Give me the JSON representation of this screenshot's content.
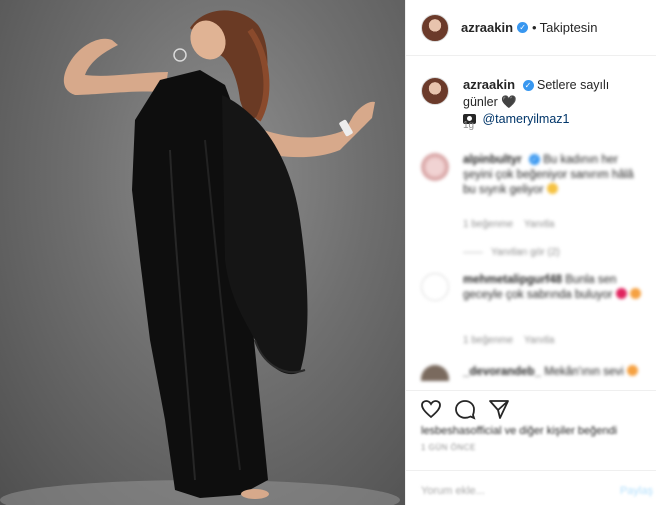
{
  "header": {
    "username": "azraakin",
    "separator": "•",
    "follow_status": "Takiptesin"
  },
  "caption": {
    "username": "azraakin",
    "text": "Setlere sayılı günler",
    "heart": "🖤",
    "camera_icon": "camera-icon",
    "mention": "@tameryilmaz1",
    "time": "1g"
  },
  "comments": [
    {
      "username": "alpinbultyr",
      "text": "Bu kadının her şeyini çok beğeniyor sanırım hâlâ bu sıyrık geliyor",
      "meta_like": "1 beğenme",
      "meta_reply": "Yanıtla",
      "replies": "Yanıtları gör (2)"
    },
    {
      "username": "mehmetalipgurf48",
      "text": "Bunla sen geceyle çok sabrında buluyor",
      "meta_like": "1 beğenme",
      "meta_reply": "Yanıtla"
    },
    {
      "username": "_devorandeb_",
      "text": "Mekân'ının sevi"
    }
  ],
  "actions": {
    "like_icon": "heart-icon",
    "comment_icon": "comment-icon",
    "share_icon": "share-icon",
    "likes_text": "lesbeshasofficial ve diğer kişiler beğendi",
    "date": "1 GÜN ÖNCE"
  },
  "add_comment": {
    "placeholder": "Yorum ekle...",
    "post_label": "Paylaş"
  },
  "colors": {
    "verified": "#3897f0",
    "mention": "#003569",
    "border": "#efefef"
  }
}
